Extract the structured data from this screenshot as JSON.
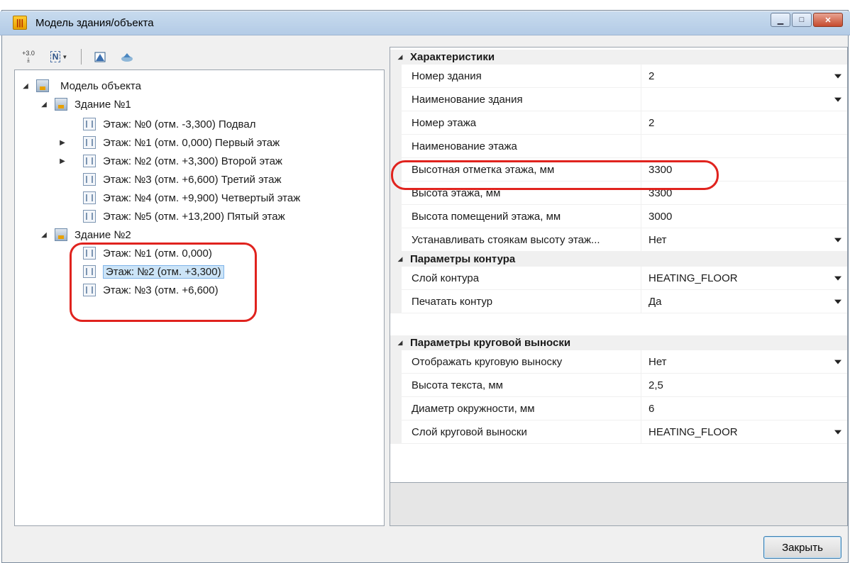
{
  "window": {
    "title": "Модель здания/объекта"
  },
  "tree": {
    "root": "Модель объекта",
    "building1": {
      "label": "Здание №1",
      "floors": [
        "Этаж: №0 (отм. -3,300) Подвал",
        "Этаж: №1 (отм. 0,000) Первый этаж",
        "Этаж: №2 (отм. +3,300) Второй этаж",
        "Этаж: №3 (отм. +6,600) Третий этаж",
        "Этаж: №4 (отм. +9,900) Четвертый этаж",
        "Этаж: №5 (отм. +13,200) Пятый этаж"
      ]
    },
    "building2": {
      "label": "Здание №2",
      "floors": [
        "Этаж: №1 (отм. 0,000)",
        "Этаж: №2 (отм. +3,300)",
        "Этаж: №3 (отм. +6,600)"
      ]
    }
  },
  "properties": {
    "cat1": {
      "label": "Характеристики",
      "rows": [
        {
          "name": "Номер здания",
          "value": "2"
        },
        {
          "name": "Наименование здания",
          "value": ""
        },
        {
          "name": "Номер этажа",
          "value": "2"
        },
        {
          "name": "Наименование этажа",
          "value": ""
        },
        {
          "name": "Высотная отметка этажа, мм",
          "value": "3300"
        },
        {
          "name": "Высота этажа, мм",
          "value": "3300"
        },
        {
          "name": "Высота помещений этажа, мм",
          "value": "3000"
        },
        {
          "name": "Устанавливать стоякам высоту этаж...",
          "value": "Нет"
        }
      ]
    },
    "cat2": {
      "label": "Параметры контура",
      "rows": [
        {
          "name": "Слой контура",
          "value": "HEATING_FLOOR"
        },
        {
          "name": "Печатать контур",
          "value": "Да"
        }
      ]
    },
    "cat3": {
      "label": "Параметры круговой выноски",
      "rows": [
        {
          "name": "Отображать круговую выноску",
          "value": "Нет"
        },
        {
          "name": "Высота текста, мм",
          "value": "2,5"
        },
        {
          "name": "Диаметр окружности, мм",
          "value": "6"
        },
        {
          "name": "Слой круговой выноски",
          "value": "HEATING_FLOOR"
        }
      ]
    }
  },
  "toolbar": {
    "elevation_label": "+3.0",
    "numbering_label": "N"
  },
  "buttons": {
    "close": "Закрыть"
  },
  "colors": {
    "annotation": "#e0231e",
    "selection": "#cce4f7"
  }
}
